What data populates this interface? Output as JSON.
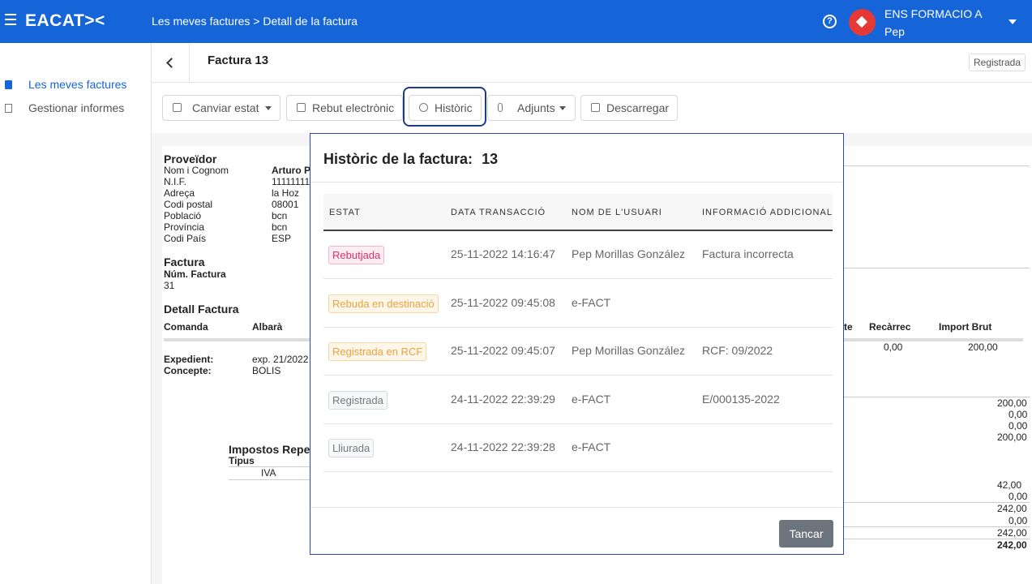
{
  "topbar": {
    "logo": "EACAT><",
    "breadcrumb": "Les meves factures > Detall de la factura",
    "help": "?",
    "org_name": "ENS FORMACIO A",
    "user_name": "Pep",
    "color": "#1565d8"
  },
  "sidebar": {
    "items": [
      {
        "label": "Les meves factures",
        "icon": "document-icon",
        "active": true
      },
      {
        "label": "Gestionar informes",
        "icon": "report-icon",
        "active": false
      }
    ]
  },
  "page": {
    "title": "Factura 13",
    "status": "Registrada"
  },
  "toolbar": {
    "change_status": "Canviar estat",
    "electronic_receipt": "Rebut electrònic",
    "history": "Històric",
    "attachments": "Adjunts",
    "download": "Descarregar"
  },
  "document": {
    "supplier_heading": "Proveïdor",
    "supplier_labels": [
      "Nom i Cognom",
      "N.I.F.",
      "Adreça",
      "Codi postal",
      "Població",
      "Província",
      "Codi País"
    ],
    "supplier_values": [
      "Arturo P",
      "11111111",
      "la Hoz",
      "08001",
      "bcn",
      "bcn",
      "ESP"
    ],
    "invoice_heading": "Factura",
    "invoice_number_label": "Núm. Factura",
    "invoice_number": "31",
    "detail_heading": "Detall Factura",
    "col_order": "Comanda",
    "col_delivery": "Albarà",
    "col_te": "te",
    "col_surcharge": "Recàrrec",
    "col_gross": "Import Brut",
    "surcharge_value": "0,00",
    "gross_value": "200,00",
    "expedient_label": "Expedient:",
    "expedient_value": "exp. 21/2022",
    "concept_label": "Concepte:",
    "concept_value": "BOLIS",
    "taxes_heading": "Impostos Repe",
    "taxes_type_label": "Tipus",
    "taxes_type_value": "IVA",
    "totals": [
      "200,00",
      "0,00",
      "0,00",
      "200,00",
      "42,00",
      "0,00",
      "242,00",
      "0,00",
      "242,00",
      "242,00"
    ]
  },
  "modal": {
    "title": "Històric de la factura:",
    "invoice_num": "13",
    "headers": [
      "ESTAT",
      "DATA TRANSACCIÓ",
      "NOM DE L'USUARI",
      "INFORMACIÓ ADDICIONAL"
    ],
    "rows": [
      {
        "status": "Rebutjada",
        "date": "25-11-2022 14:16:47",
        "user": "Pep Morillas González",
        "info": "Factura incorrecta"
      },
      {
        "status": "Rebuda en destinació",
        "date": "25-11-2022 09:45:08",
        "user": "e-FACT",
        "info": ""
      },
      {
        "status": "Registrada en RCF",
        "date": "25-11-2022 09:45:07",
        "user": "Pep Morillas González",
        "info": "RCF: 09/2022"
      },
      {
        "status": "Registrada",
        "date": "24-11-2022 22:39:29",
        "user": "e-FACT",
        "info": "E/000135-2022"
      },
      {
        "status": "Lliurada",
        "date": "24-11-2022 22:39:28",
        "user": "e-FACT",
        "info": ""
      }
    ],
    "close_label": "Tancar",
    "badge_colors": {
      "Rebutjada": "#d6336c",
      "Rebuda en destinació": "#e8a33d",
      "Registrada en RCF": "#e8a33d",
      "Registrada": "#8a8f98",
      "Lliurada": "#8a8f98"
    }
  }
}
